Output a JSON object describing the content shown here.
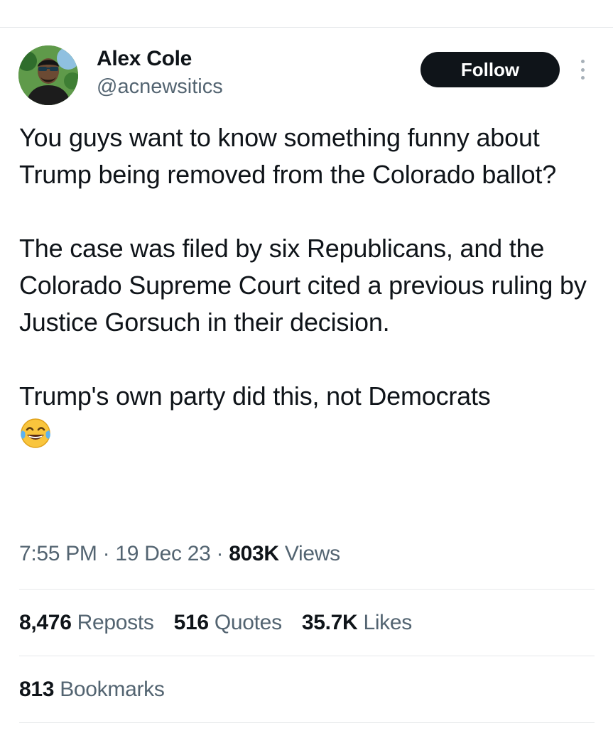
{
  "author": {
    "name": "Alex Cole",
    "handle": "@acnewsitics",
    "avatar_icon": "profile-photo"
  },
  "header": {
    "follow_label": "Follow",
    "more_icon": "vertical-dots-icon"
  },
  "tweet": {
    "paragraphs": [
      "You guys want to know something funny about Trump being removed from the Colorado ballot?",
      "The case was filed by six Republicans, and the Colorado Supreme Court cited a previous ruling by Justice Gorsuch in their decision.",
      "Trump's own party did this, not Democrats"
    ],
    "emoji": "😂",
    "emoji_icon": "tears-of-joy-emoji"
  },
  "meta": {
    "time": "7:55 PM",
    "separator": "·",
    "date": "19 Dec 23",
    "views_count": "803K",
    "views_label": "Views"
  },
  "stats": {
    "reposts_count": "8,476",
    "reposts_label": "Reposts",
    "quotes_count": "516",
    "quotes_label": "Quotes",
    "likes_count": "35.7K",
    "likes_label": "Likes",
    "bookmarks_count": "813",
    "bookmarks_label": "Bookmarks"
  },
  "colors": {
    "text": "#0f1419",
    "secondary": "#536471",
    "divider": "#e6e8ea",
    "button_bg": "#0f1419"
  }
}
